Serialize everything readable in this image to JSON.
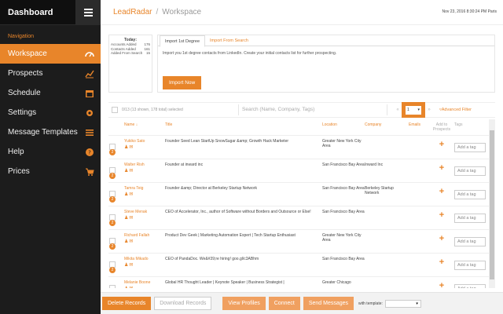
{
  "sidebar": {
    "title": "Dashboard",
    "nav_label": "Navigation",
    "items": [
      {
        "label": "Workspace",
        "icon": "dashboard-gauge-icon"
      },
      {
        "label": "Prospects",
        "icon": "trend-chart-icon"
      },
      {
        "label": "Schedule",
        "icon": "calendar-icon"
      },
      {
        "label": "Settings",
        "icon": "gear-icon"
      },
      {
        "label": "Message Templates",
        "icon": "list-icon"
      },
      {
        "label": "Help",
        "icon": "question-icon"
      },
      {
        "label": "Prices",
        "icon": "cart-icon"
      }
    ]
  },
  "header": {
    "brand": "LeadRadar",
    "separator": "/",
    "crumb": "Workspace",
    "timestamp": "Nov 23, 2016 8:30:24 PM Paris"
  },
  "stats": {
    "title": "Today:",
    "rows": [
      {
        "label": "Accounts Added",
        "value": "176"
      },
      {
        "label": "Contacts Added",
        "value": "161"
      },
      {
        "label": "Added From Search",
        "value": "15"
      }
    ]
  },
  "import": {
    "tabs": [
      "Import 1st Degree",
      "Import From Search"
    ],
    "description": "Import you 1st degree contacts from LinkedIn. Create your initial contacts list for further prospecting.",
    "button": "Import Now"
  },
  "toolbar": {
    "selected": "0/13 (13 shown, 178 total) selected",
    "search_placeholder": "Search (Name, Company, Tags)",
    "prev": "«",
    "next": "»",
    "page": "1",
    "advanced_filter": "Advanced Filter"
  },
  "table": {
    "headers": {
      "name": "Name ↓",
      "title": "Title",
      "location": "Location",
      "company": "Company",
      "emails": "Emails",
      "add": "Add to Prospects",
      "tags": "Tags"
    },
    "tag_placeholder": "Add a tag",
    "rows": [
      {
        "name": "Yukiko Sato",
        "title": "Founder Seed Lean StartUp SnowSugar &amp; Growth Hack Marketer",
        "location": "Greater New York City Area",
        "company": "",
        "badge": "2"
      },
      {
        "name": "Walter Rish",
        "title": "Founder at inward inc",
        "location": "San Francisco Bay Area",
        "company": "Inward Inc",
        "badge": "2"
      },
      {
        "name": "Tamra Teig",
        "title": "Founder &amp; Director at Berkeley Startup Network",
        "location": "San Francisco Bay Area",
        "company": "Berkeley Startup Network",
        "badge": "2"
      },
      {
        "name": "Steve Menak",
        "title": "CEO of Accelerator, Inc., author of Software without Borders and Outsource or Else!",
        "location": "San Francisco Bay Area",
        "company": "",
        "badge": "2"
      },
      {
        "name": "Richard Fallah",
        "title": "Product Dev Geek | Marketing Automation Expert | Tech Startup Enthusiast",
        "location": "Greater New York City Area",
        "company": "",
        "badge": "2"
      },
      {
        "name": "Mikita Mikado",
        "title": "CEO of PandaDoc. We&#39;re hiring! goo.gl/c3ABhm",
        "location": "San Francisco Bay Area",
        "company": "",
        "badge": "2"
      },
      {
        "name": "Melanie Boone",
        "title": "Global HR Thought Leader | Keynote Speaker | Business Strategist |",
        "location": "Greater Chicago",
        "company": "",
        "badge": "2"
      }
    ]
  },
  "footer": {
    "delete": "Delete Records",
    "download": "Download Records",
    "view": "View Profiles",
    "connect": "Connect",
    "send": "Send Messages",
    "with_template": "with template:",
    "template_value": "▾"
  },
  "colors": {
    "accent": "#e8852a",
    "sidebar": "#1c1c1c"
  }
}
